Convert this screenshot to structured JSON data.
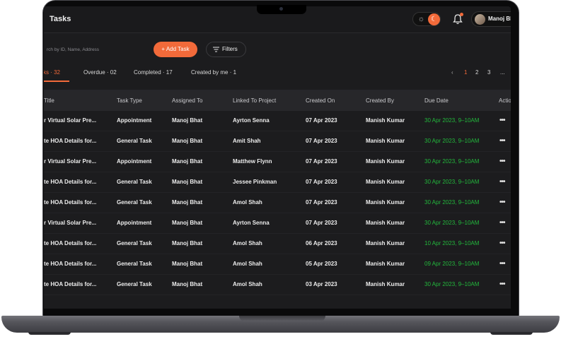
{
  "header": {
    "title": "Tasks",
    "user_name": "Manoj Bhat",
    "accent_color": "#f26a3a"
  },
  "toolbar": {
    "search_placeholder": "rch by ID, Name, Address",
    "add_task_label": "+ Add Task",
    "filters_label": "Filters"
  },
  "tabs": [
    {
      "label": "ks · 32",
      "active": true
    },
    {
      "label": "Overdue · 02"
    },
    {
      "label": "Completed · 17"
    },
    {
      "label": "Created by me · 1"
    }
  ],
  "pagination": {
    "prev": "‹",
    "pages": [
      "1",
      "2",
      "3"
    ],
    "more": "...",
    "current": "1"
  },
  "table": {
    "columns": [
      "Title",
      "Task Type",
      "Assigned To",
      "Linked To Project",
      "Created On",
      "Created By",
      "Due Date",
      "Actio"
    ],
    "rows": [
      {
        "title": "r Virtual Solar  Pre...",
        "type": "Appointment",
        "assigned": "Manoj Bhat",
        "project": "Ayrton Senna",
        "created": "07 Apr 2023",
        "by": "Manish Kumar",
        "due": "30 Apr 2023, 9–10AM"
      },
      {
        "title": "te HOA Details for...",
        "type": "General Task",
        "assigned": "Manoj Bhat",
        "project": "Amit Shah",
        "created": "07 Apr 2023",
        "by": "Manish Kumar",
        "due": "30 Apr 2023, 9–10AM"
      },
      {
        "title": "r Virtual Solar  Pre...",
        "type": "Appointment",
        "assigned": "Manoj Bhat",
        "project": "Matthew Flynn",
        "created": "07 Apr 2023",
        "by": "Manish Kumar",
        "due": "30 Apr 2023, 9–10AM"
      },
      {
        "title": "te HOA Details for...",
        "type": "General Task",
        "assigned": "Manoj Bhat",
        "project": "Jessee Pinkman",
        "created": "07 Apr 2023",
        "by": "Manish Kumar",
        "due": "30 Apr 2023, 9–10AM"
      },
      {
        "title": "te HOA Details for...",
        "type": "General Task",
        "assigned": "Manoj Bhat",
        "project": "Amol Shah",
        "created": "07 Apr 2023",
        "by": "Manish Kumar",
        "due": "30 Apr 2023, 9–10AM"
      },
      {
        "title": "r Virtual Solar  Pre...",
        "type": "Appointment",
        "assigned": "Manoj Bhat",
        "project": "Ayrton Senna",
        "created": "07 Apr 2023",
        "by": "Manish Kumar",
        "due": "30 Apr 2023, 9–10AM"
      },
      {
        "title": "te HOA Details for...",
        "type": "General Task",
        "assigned": "Manoj Bhat",
        "project": "Amol Shah",
        "created": "06 Apr 2023",
        "by": "Manish Kumar",
        "due": "10 Apr 2023, 9–10AM"
      },
      {
        "title": "te HOA Details for...",
        "type": "General Task",
        "assigned": "Manoj Bhat",
        "project": "Amol Shah",
        "created": "05 Apr 2023",
        "by": "Manish Kumar",
        "due": "09 Apr 2023, 9–10AM"
      },
      {
        "title": "te HOA Details for...",
        "type": "General Task",
        "assigned": "Manoj Bhat",
        "project": "Amol Shah",
        "created": "03 Apr 2023",
        "by": "Manish Kumar",
        "due": "30 Apr 2023, 9–10AM"
      }
    ],
    "due_color": "#22b83c",
    "row_action_icon": "more-horizontal-icon"
  }
}
